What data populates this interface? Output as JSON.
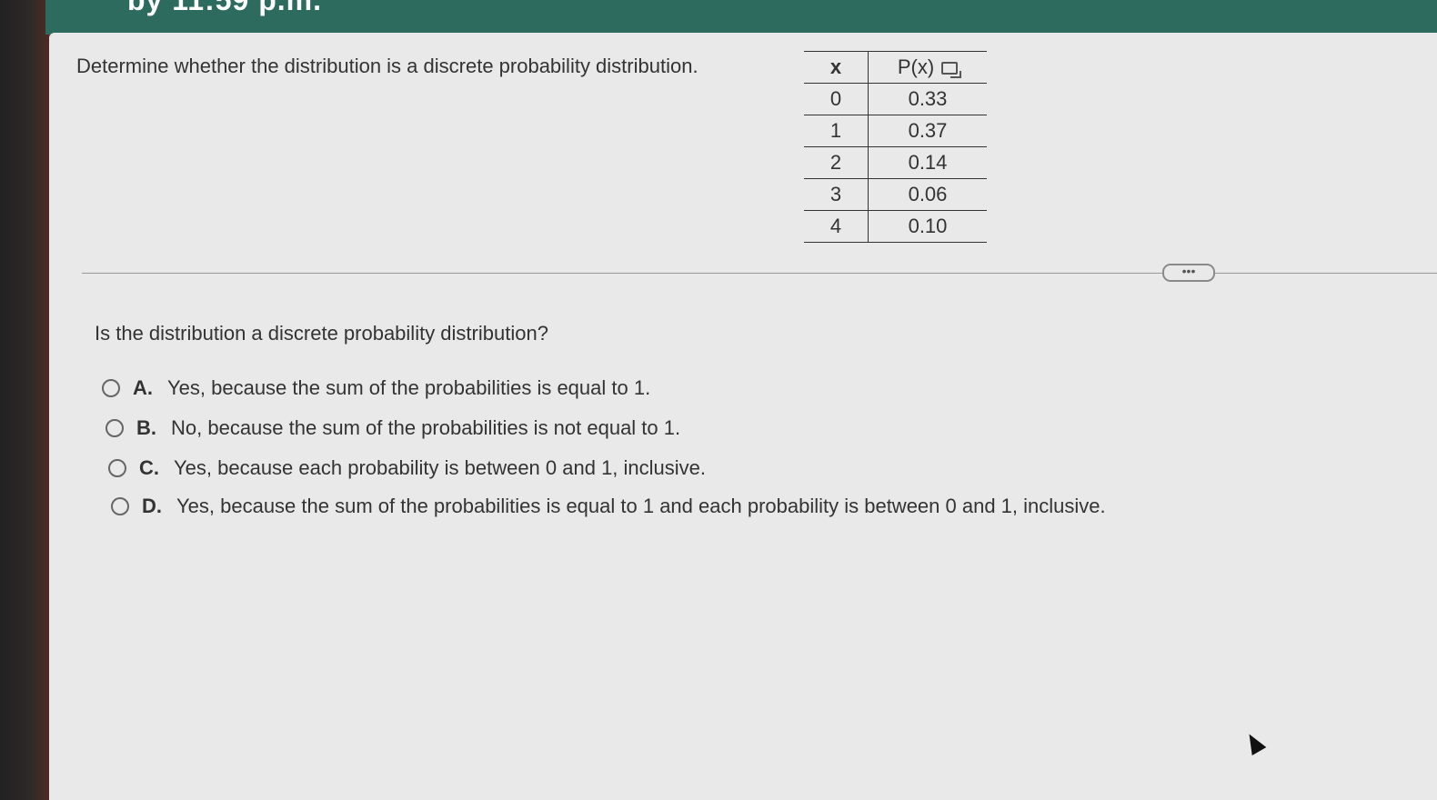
{
  "header": {
    "due_text": "by 11:59 p.m."
  },
  "question": {
    "prompt": "Determine whether the distribution is a discrete probability distribution."
  },
  "table": {
    "headers": [
      "x",
      "P(x)"
    ],
    "rows": [
      [
        "0",
        "0.33"
      ],
      [
        "1",
        "0.37"
      ],
      [
        "2",
        "0.14"
      ],
      [
        "3",
        "0.06"
      ],
      [
        "4",
        "0.10"
      ]
    ]
  },
  "more_button": {
    "label": "•••"
  },
  "subquestion": {
    "text": "Is the distribution a discrete probability distribution?"
  },
  "options": [
    {
      "letter": "A.",
      "text": "Yes, because the sum of the probabilities is equal to 1."
    },
    {
      "letter": "B.",
      "text": "No, because the sum of the probabilities is not equal to 1."
    },
    {
      "letter": "C.",
      "text": "Yes, because each probability is between 0 and 1, inclusive."
    },
    {
      "letter": "D.",
      "text": "Yes, because the sum of the probabilities is equal to 1 and each probability is between 0 and 1, inclusive."
    }
  ],
  "icons": {
    "copy": "copy-icon",
    "cursor": "cursor-icon"
  },
  "colors": {
    "header_bar": "#2d6b5e",
    "panel": "#e9e9e9"
  }
}
